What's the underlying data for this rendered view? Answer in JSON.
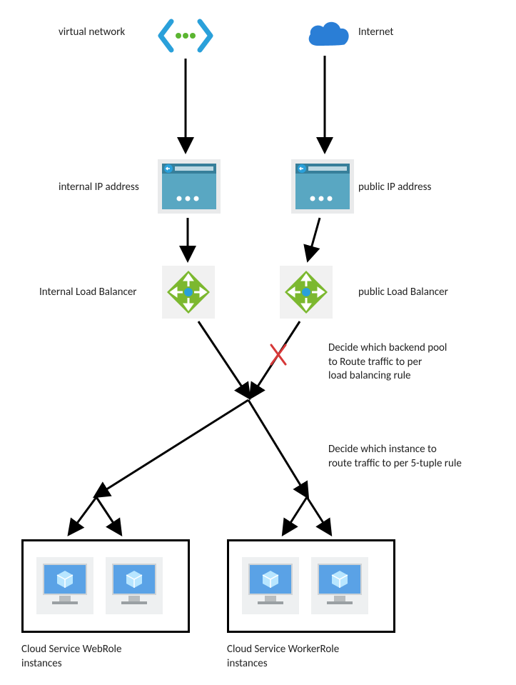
{
  "labels": {
    "vnet": "virtual network",
    "internet": "Internet",
    "internal_ip": "internal IP address",
    "public_ip": "public IP address",
    "internal_lb": "Internal Load Balancer",
    "public_lb": "public Load Balancer",
    "decide_pool": "Decide which backend pool\nto Route traffic to per\nload balancing rule",
    "decide_instance": "Decide which instance to\nroute traffic to per 5-tuple rule",
    "webrole": "Cloud Service WebRole\ninstances",
    "workerrole": "Cloud Service WorkerRole\ninstances"
  },
  "colors": {
    "blue_icon": "#2aa0da",
    "green_lb": "#7cb82f",
    "dot_green": "#5bb531",
    "cloud": "#2a7ed6",
    "monitor_blue": "#5aa2e6",
    "monitor_cube": "#b8e6ff",
    "red_x": "#d63838"
  }
}
